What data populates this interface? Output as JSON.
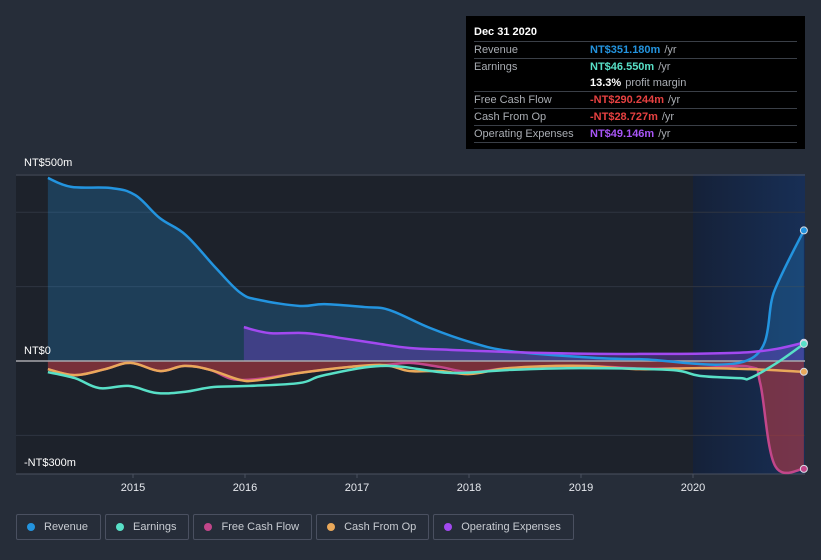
{
  "tooltip": {
    "date": "Dec 31 2020",
    "rows": [
      {
        "label": "Revenue",
        "value": "NT$351.180m",
        "suffix": "/yr",
        "color": "#2394df"
      },
      {
        "label": "Earnings",
        "value": "NT$46.550m",
        "suffix": "/yr",
        "color": "#58e0c7"
      },
      {
        "label": "",
        "value": "13.3%",
        "suffix": "profit margin",
        "color": "#ffffff"
      },
      {
        "label": "Free Cash Flow",
        "value": "-NT$290.244m",
        "suffix": "/yr",
        "color": "#e64141"
      },
      {
        "label": "Cash From Op",
        "value": "-NT$28.727m",
        "suffix": "/yr",
        "color": "#e64141"
      },
      {
        "label": "Operating Expenses",
        "value": "NT$49.146m",
        "suffix": "/yr",
        "color": "#a855f7"
      }
    ]
  },
  "legend": [
    {
      "label": "Revenue",
      "color": "#2394df"
    },
    {
      "label": "Earnings",
      "color": "#58e0c7"
    },
    {
      "label": "Free Cash Flow",
      "color": "#c2468a"
    },
    {
      "label": "Cash From Op",
      "color": "#e9a85a"
    },
    {
      "label": "Operating Expenses",
      "color": "#a249f0"
    }
  ],
  "chart_data": {
    "type": "line",
    "title": "",
    "xlabel": "",
    "ylabel": "",
    "y_unit": "NT$ millions",
    "ylim": [
      -300,
      500
    ],
    "y_tick_labels": [
      {
        "value": 500,
        "label": "NT$500m"
      },
      {
        "value": 0,
        "label": "NT$0"
      },
      {
        "value": -300,
        "label": "-NT$300m"
      }
    ],
    "y_gridlines": [
      400,
      200,
      -200
    ],
    "xlim": [
      2013.7,
      2021.0
    ],
    "x_ticks": [
      2015,
      2016,
      2017,
      2018,
      2019,
      2020
    ],
    "x_tick_labels": [
      "2015",
      "2016",
      "2017",
      "2018",
      "2019",
      "2020"
    ],
    "highlight_range": [
      2020.0,
      2021.0
    ],
    "grid": true,
    "legend_position": "bottom",
    "series": [
      {
        "name": "Revenue",
        "color": "#2394df",
        "fill": true,
        "x": [
          2014.24,
          2014.45,
          2014.8,
          2015.02,
          2015.24,
          2015.47,
          2015.74,
          2015.96,
          2016.13,
          2016.49,
          2016.71,
          2017.07,
          2017.29,
          2017.65,
          2018.01,
          2018.36,
          2018.99,
          2019.52,
          2020.51,
          2020.73,
          2020.99
        ],
        "y": [
          492,
          468,
          465,
          446,
          384,
          339,
          250,
          183,
          164,
          148,
          153,
          145,
          137,
          89,
          51,
          27,
          11,
          5,
          5,
          191,
          351
        ]
      },
      {
        "name": "Earnings",
        "color": "#58e0c7",
        "fill": false,
        "x": [
          2014.24,
          2014.48,
          2014.7,
          2014.96,
          2015.21,
          2015.46,
          2015.72,
          2016.04,
          2016.49,
          2016.71,
          2017.25,
          2017.83,
          2018.36,
          2018.99,
          2019.79,
          2020.06,
          2020.42,
          2020.51,
          2020.75,
          2020.99
        ],
        "y": [
          -30,
          -46,
          -73,
          -67,
          -86,
          -83,
          -70,
          -67,
          -59,
          -38,
          -13,
          -32,
          -24,
          -19,
          -24,
          -40,
          -46,
          -46,
          -5,
          46
        ]
      },
      {
        "name": "Free Cash Flow",
        "color": "#c2468a",
        "fill": true,
        "x": [
          2014.24,
          2014.48,
          2014.75,
          2014.98,
          2015.24,
          2015.46,
          2015.69,
          2015.96,
          2016.49,
          2016.93,
          2017.25,
          2017.47,
          2017.74,
          2018.01,
          2018.36,
          2018.99,
          2019.52,
          2020.06,
          2020.51,
          2020.6,
          2020.73,
          2020.99
        ],
        "y": [
          -22,
          -38,
          -22,
          -5,
          -27,
          -13,
          -24,
          -51,
          -32,
          -16,
          -11,
          -5,
          -16,
          -30,
          -19,
          -13,
          -20,
          -19,
          -16,
          -60,
          -280,
          -290
        ]
      },
      {
        "name": "Cash From Op",
        "color": "#e9a85a",
        "fill": false,
        "x": [
          2014.24,
          2014.48,
          2014.75,
          2014.98,
          2015.24,
          2015.46,
          2015.69,
          2015.96,
          2016.13,
          2016.49,
          2016.93,
          2017.25,
          2017.47,
          2017.74,
          2018.01,
          2018.36,
          2018.99,
          2019.52,
          2020.06,
          2020.51,
          2020.99
        ],
        "y": [
          -22,
          -38,
          -22,
          -5,
          -27,
          -13,
          -24,
          -51,
          -51,
          -32,
          -16,
          -11,
          -27,
          -27,
          -35,
          -19,
          -13,
          -22,
          -19,
          -22,
          -29
        ]
      },
      {
        "name": "Operating Expenses",
        "color": "#a249f0",
        "fill": true,
        "x": [
          2015.99,
          2016.22,
          2016.54,
          2016.85,
          2017.16,
          2017.47,
          2017.83,
          2018.63,
          2019.52,
          2020.51,
          2020.99
        ],
        "y": [
          91,
          75,
          75,
          62,
          48,
          35,
          30,
          22,
          19,
          24,
          49
        ]
      }
    ]
  }
}
